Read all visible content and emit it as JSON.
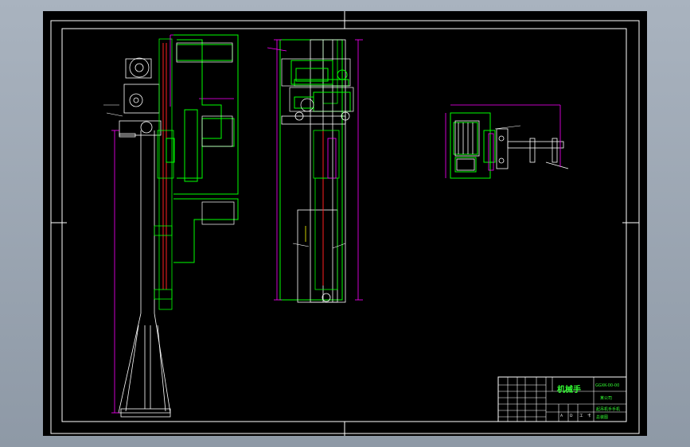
{
  "drawing": {
    "title_block": {
      "title": "机械手",
      "code": "GGXK-00-00",
      "company": "某公司",
      "drawing_name": "起吊机手手机",
      "sheet_info": "总装图",
      "scale_row": [
        "A",
        "D",
        "工",
        "卡"
      ]
    }
  },
  "colors": {
    "background": "#000000",
    "outer_bg": "#9aa5b1",
    "frame": "#ffffff",
    "part": "#00ff00",
    "dimension": "#ff00ff",
    "red_line": "#ff2020",
    "yellow": "#ffff00",
    "title_green": "#33ff33"
  }
}
